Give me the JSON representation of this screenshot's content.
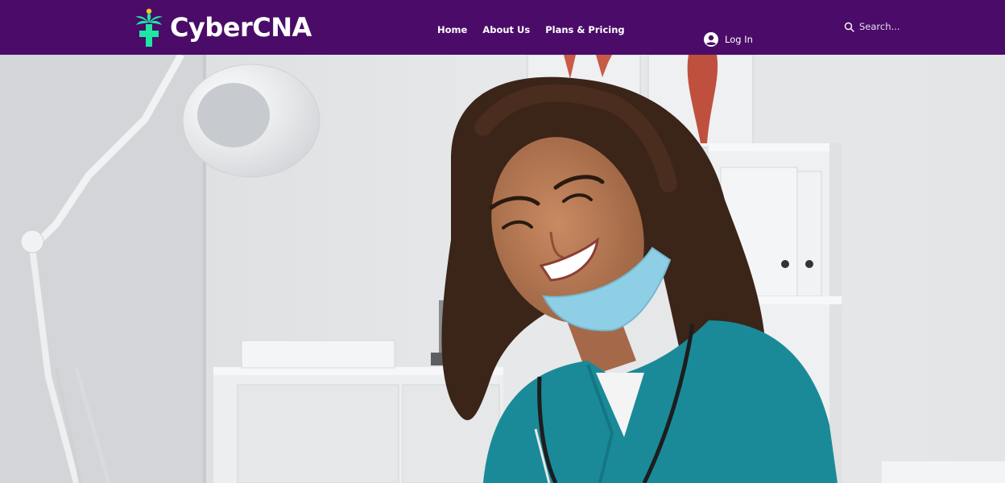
{
  "brand": {
    "name": "CyberCNA",
    "logo_icon": "medical-cross-palm-icon",
    "header_bg": "#4a0c68",
    "accent_green": "#1ee6a3",
    "accent_yellow": "#f3c623"
  },
  "nav": {
    "items": [
      {
        "label": "Home"
      },
      {
        "label": "About Us"
      },
      {
        "label": "Plans & Pricing"
      }
    ]
  },
  "login": {
    "label": "Log In",
    "icon": "user-avatar-icon"
  },
  "search": {
    "placeholder": "Search...",
    "icon": "search-icon"
  },
  "hero": {
    "image": "smiling-nurse-in-teal-scrubs-photo"
  }
}
